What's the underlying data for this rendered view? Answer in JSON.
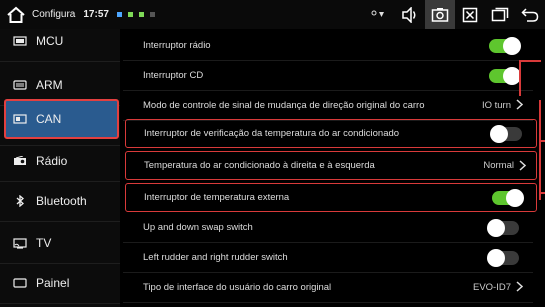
{
  "status_bar": {
    "title": "Configura",
    "time": "17:57",
    "dot_colors": [
      "#4da6ff",
      "#7ed957",
      "#7ed957",
      "#555555"
    ]
  },
  "sidebar": {
    "items": [
      {
        "label": "MCU",
        "icon": "mcu-icon"
      },
      {
        "label": "ARM",
        "icon": "arm-icon"
      },
      {
        "label": "CAN",
        "icon": "can-icon",
        "selected": true
      },
      {
        "label": "Rádio",
        "icon": "radio-icon"
      },
      {
        "label": "Bluetooth",
        "icon": "bluetooth-icon"
      },
      {
        "label": "TV",
        "icon": "tv-icon"
      },
      {
        "label": "Painel",
        "icon": "panel-icon"
      }
    ]
  },
  "settings": [
    {
      "label": "Interruptor rádio",
      "type": "toggle",
      "on": true
    },
    {
      "label": "Interruptor CD",
      "type": "toggle",
      "on": true
    },
    {
      "label": "Modo de controle de sinal de mudança de direção original do carro",
      "type": "select",
      "value": "IO turn"
    },
    {
      "label": "Interruptor de verificação da temperatura do ar condicionado",
      "type": "toggle",
      "on": false,
      "highlighted": true
    },
    {
      "label": "Temperatura do ar condicionado à direita e à esquerda",
      "type": "select",
      "value": "Normal",
      "highlighted": true
    },
    {
      "label": "Interruptor de temperatura externa",
      "type": "toggle",
      "on": true,
      "highlighted": true
    },
    {
      "label": "Up and down swap switch",
      "type": "toggle",
      "on": false
    },
    {
      "label": "Left rudder and right rudder switch",
      "type": "toggle",
      "on": false
    },
    {
      "label": "Tipo de interface do usuário do carro original",
      "type": "select",
      "value": "EVO-ID7"
    }
  ],
  "colors": {
    "accent_selected": "#2a5b8f",
    "highlight": "#d93a3a",
    "toggle_on": "#5ec62e",
    "toggle_off": "#3a3a3a"
  }
}
